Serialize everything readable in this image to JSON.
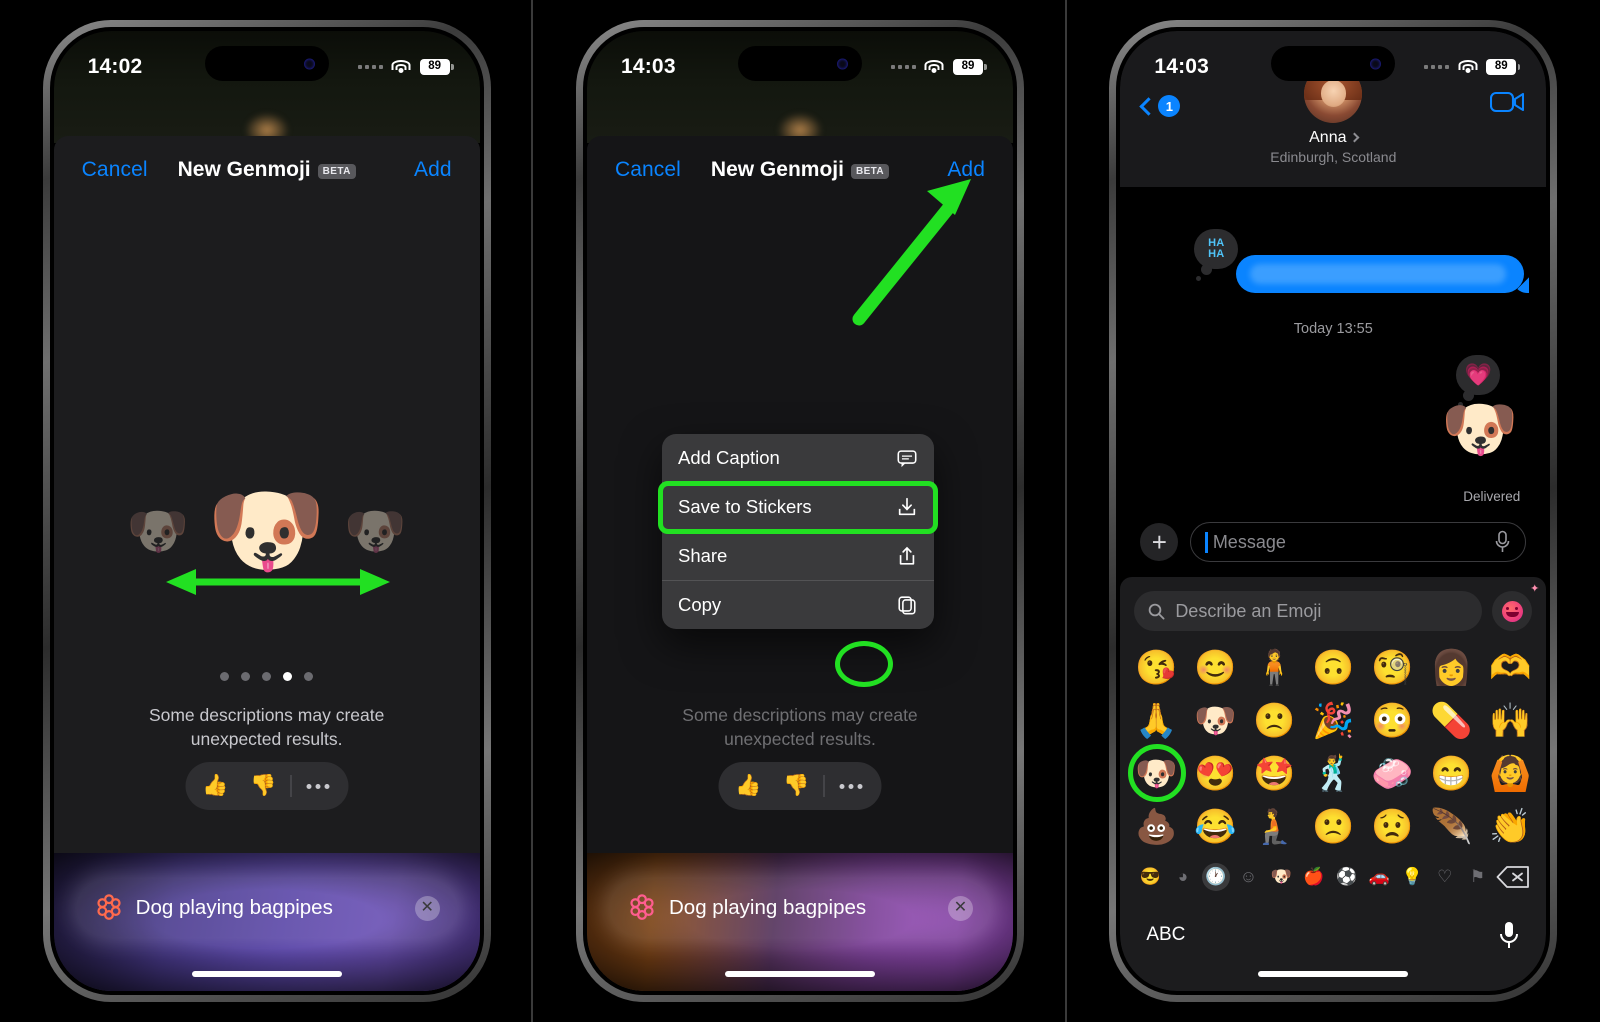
{
  "panels": [
    {
      "id": "panel-genmoji-carousel",
      "status_bar": {
        "time": "14:02",
        "battery": "89",
        "wifi_icon": "wifi-icon",
        "signal_icon": "signal-dots-icon"
      },
      "nav": {
        "cancel_label": "Cancel",
        "title": "New Genmoji",
        "beta_label": "BETA",
        "add_label": "Add"
      },
      "carousel": {
        "left_emoji": "🐶",
        "main_emoji": "🐶",
        "right_emoji": "🐶",
        "dot_count": 5,
        "active_dot": 4,
        "swipe_hint_icon": "double-arrow-icon"
      },
      "disclaimer": "Some descriptions may create unexpected results.",
      "feedback": {
        "thumbs_up_icon": "thumbs-up-icon",
        "thumbs_down_icon": "thumbs-down-icon",
        "more_icon": "ellipsis-icon"
      },
      "prompt": {
        "value": "Dog playing bagpipes",
        "ai_icon": "apple-intelligence-icon",
        "clear_icon": "clear-x-icon",
        "glow": "purple"
      }
    },
    {
      "id": "panel-genmoji-context-menu",
      "status_bar": {
        "time": "14:03",
        "battery": "89",
        "wifi_icon": "wifi-icon",
        "signal_icon": "signal-dots-icon"
      },
      "nav": {
        "cancel_label": "Cancel",
        "title": "New Genmoji",
        "beta_label": "BETA",
        "add_label": "Add"
      },
      "annotation_arrow": "green-arrow-to-add",
      "context_menu": [
        {
          "label": "Add Caption",
          "icon": "caption-bubble-icon",
          "highlighted": false
        },
        {
          "label": "Save to Stickers",
          "icon": "save-download-icon",
          "highlighted": true
        },
        {
          "label": "Share",
          "icon": "share-icon",
          "highlighted": false
        },
        {
          "label": "Copy",
          "icon": "copy-icon",
          "highlighted": false
        }
      ],
      "feedback": {
        "thumbs_up_icon": "thumbs-up-icon",
        "thumbs_down_icon": "thumbs-down-icon",
        "more_icon": "ellipsis-icon",
        "more_highlighted": true
      },
      "prompt": {
        "value": "Dog playing bagpipes",
        "ai_icon": "apple-intelligence-icon",
        "clear_icon": "clear-x-icon",
        "glow": "orange-purple"
      }
    },
    {
      "id": "panel-messages-sticker-sent",
      "status_bar": {
        "time": "14:03",
        "battery": "89",
        "wifi_icon": "wifi-icon",
        "signal_icon": "signal-dots-icon"
      },
      "header": {
        "back_badge": "1",
        "back_icon": "chevron-left-icon",
        "contact_name": "Anna",
        "contact_subtitle": "Edinburgh, Scotland",
        "avatar_icon": "contact-avatar",
        "facetime_icon": "video-camera-icon"
      },
      "conversation": {
        "sent_bubble_tapback": "HA\nHA",
        "timestamp": "Today 13:55",
        "sticker_emoji": "🐶",
        "sticker_tapback": "💗",
        "status": "Delivered"
      },
      "message_input": {
        "add_icon": "plus-icon",
        "placeholder": "Message",
        "mic_icon": "microphone-icon"
      },
      "keyboard": {
        "search_placeholder": "Describe an Emoji",
        "search_icon": "search-icon",
        "genmoji_button_icon": "create-genmoji-icon",
        "emoji_rows": [
          [
            "😘",
            "😊",
            "🧍",
            "🙃",
            "🧐",
            "👩",
            "🫶"
          ],
          [
            "🙏",
            "🐶",
            "🙁",
            "🎉",
            "😳",
            "💊",
            "🙌"
          ],
          [
            "🐶",
            "😍",
            "🤩",
            "🕺",
            "🧼",
            "😁",
            "🙆"
          ],
          [
            "💩",
            "😂",
            "🧎",
            "🙁",
            "😟",
            "🪶",
            "👏"
          ]
        ],
        "highlighted_emoji": {
          "row": 3,
          "col": 1
        },
        "categories": [
          {
            "icon": "genmoji-category-icon",
            "active": false
          },
          {
            "icon": "stickers-category-icon",
            "active": false
          },
          {
            "icon": "recents-clock-icon",
            "active": true
          },
          {
            "icon": "smileys-category-icon",
            "active": false
          },
          {
            "icon": "animals-category-icon",
            "active": false
          },
          {
            "icon": "food-category-icon",
            "active": false
          },
          {
            "icon": "activity-category-icon",
            "active": false
          },
          {
            "icon": "travel-category-icon",
            "active": false
          },
          {
            "icon": "objects-category-icon",
            "active": false
          },
          {
            "icon": "symbols-category-icon",
            "active": false
          },
          {
            "icon": "flags-category-icon",
            "active": false
          },
          {
            "icon": "delete-key-icon",
            "active": false
          }
        ],
        "abc_label": "ABC",
        "dictation_icon": "microphone-icon"
      }
    }
  ],
  "colors": {
    "accent_blue": "#0a84ff",
    "annotation_green": "#22e022",
    "sheet_bg": "#1c1c1e",
    "menu_bg": "#3a3a3c"
  }
}
